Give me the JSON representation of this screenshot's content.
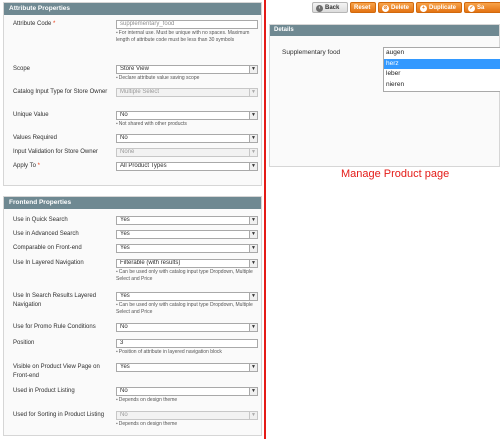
{
  "attribute_properties": {
    "title": "Attribute Properties",
    "attribute_code": {
      "label": "Attribute Code",
      "required_mark": "*",
      "value": "supplementary_food",
      "note": "For internal use. Must be unique with no spaces. Maximum length of attribute code must be less than 30 symbols"
    },
    "scope": {
      "label": "Scope",
      "value": "Store View",
      "note": "Declare attribute value saving scope"
    },
    "catalog_input_type": {
      "label": "Catalog Input Type for Store Owner",
      "value": "Multiple Select"
    },
    "unique_value": {
      "label": "Unique Value",
      "value": "No",
      "note": "Not shared with other products"
    },
    "values_required": {
      "label": "Values Required",
      "value": "No"
    },
    "input_validation": {
      "label": "Input Validation for Store Owner",
      "value": "None"
    },
    "apply_to": {
      "label": "Apply To",
      "required_mark": "*",
      "value": "All Product Types"
    }
  },
  "frontend_properties": {
    "title": "Frontend Properties",
    "quick_search": {
      "label": "Use in Quick Search",
      "value": "Yes"
    },
    "advanced_search": {
      "label": "Use in Advanced Search",
      "value": "Yes"
    },
    "comparable": {
      "label": "Comparable on Front-end",
      "value": "Yes"
    },
    "layered_navigation": {
      "label": "Use In Layered Navigation",
      "value": "Filterable (with results)",
      "note": "Can be used only with catalog input type Dropdown, Multiple Select and Price"
    },
    "search_results_layered": {
      "label": "Use In Search Results Layered Navigation",
      "value": "Yes",
      "note": "Can be used only with catalog input type Dropdown, Multiple Select and Price"
    },
    "promo_rule": {
      "label": "Use for Promo Rule Conditions",
      "value": "No"
    },
    "position": {
      "label": "Position",
      "value": "3",
      "note": "Position of attribute in layered navigation block"
    },
    "visible_on_view": {
      "label": "Visible on Product View Page on Front-end",
      "value": "Yes"
    },
    "product_listing": {
      "label": "Used in Product Listing",
      "value": "No",
      "note": "Depends on design theme"
    },
    "sorting": {
      "label": "Used for Sorting in Product Listing",
      "value": "No",
      "note": "Depends on design theme"
    }
  },
  "toolbar": {
    "back": "Back",
    "reset": "Reset",
    "delete": "Delete",
    "duplicate": "Duplicate",
    "save": "Sa"
  },
  "details": {
    "title": "Details",
    "field_label": "Supplementary food",
    "options": [
      "augen",
      "herz",
      "leber",
      "nieren"
    ],
    "selected": "herz"
  },
  "caption": "Manage Product page",
  "colors": {
    "section_header": "#6f8992",
    "button_orange": "#e47312",
    "selection": "#3399ff",
    "divider": "#e41b17"
  }
}
